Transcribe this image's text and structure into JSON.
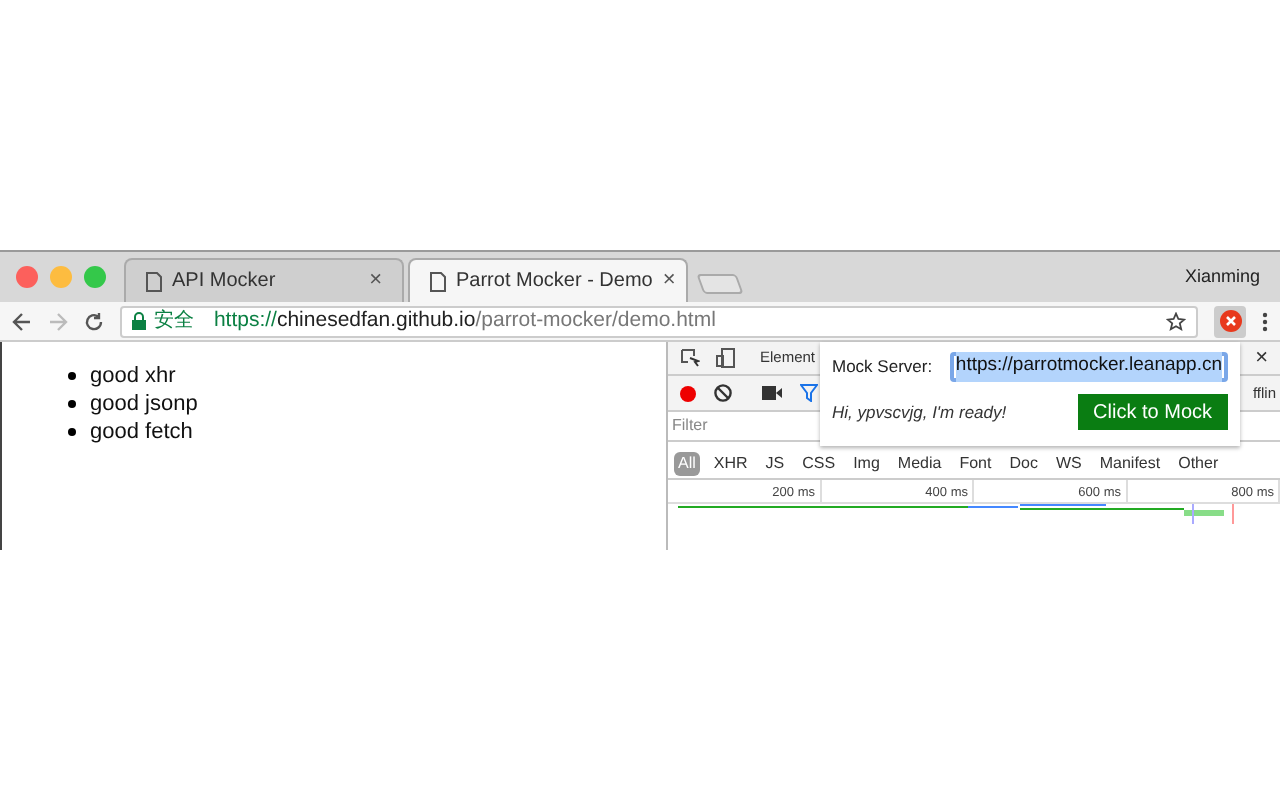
{
  "tabs": [
    {
      "title": "API Mocker",
      "selected": false,
      "close": "×"
    },
    {
      "title": "Parrot Mocker - Demo",
      "selected": true,
      "close": "×"
    }
  ],
  "profile": "Xianming",
  "address_bar": {
    "security": "安全",
    "scheme": "https://",
    "host": "chinesedfan.github.io",
    "path": "/parrot-mocker/demo.html"
  },
  "page": {
    "items": [
      "good xhr",
      "good jsonp",
      "good fetch"
    ]
  },
  "devtools": {
    "panel_tab": "Element",
    "close": "×",
    "throttle": "fflin",
    "filter": {
      "placeholder": "Filter"
    },
    "types": [
      {
        "label": "All",
        "selected": true
      },
      {
        "label": "XHR",
        "selected": false
      },
      {
        "label": "JS",
        "selected": false
      },
      {
        "label": "CSS",
        "selected": false
      },
      {
        "label": "Img",
        "selected": false
      },
      {
        "label": "Media",
        "selected": false
      },
      {
        "label": "Font",
        "selected": false
      },
      {
        "label": "Doc",
        "selected": false
      },
      {
        "label": "WS",
        "selected": false
      },
      {
        "label": "Manifest",
        "selected": false
      },
      {
        "label": "Other",
        "selected": false
      }
    ],
    "timeline_ticks": [
      "200 ms",
      "400 ms",
      "600 ms",
      "800 ms"
    ]
  },
  "popup": {
    "label": "Mock Server:",
    "value": "https://parrotmocker.leanapp.cn",
    "greeting": "Hi, ypvscvjg, I'm ready!",
    "button": "Click to Mock"
  }
}
